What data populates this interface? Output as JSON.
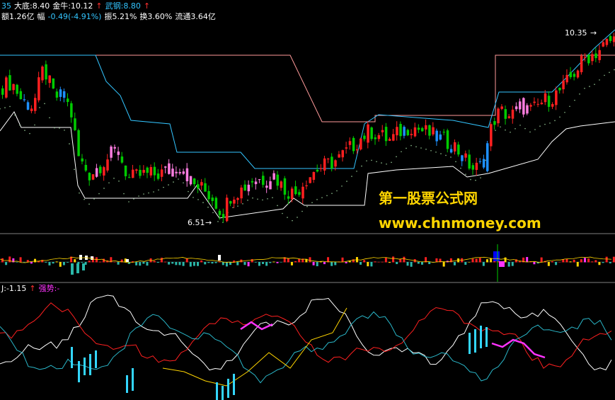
{
  "header": {
    "line1": [
      {
        "text": "35",
        "color": "#33c5ff"
      },
      {
        "text": "大底:8.40",
        "color": "#ffffff"
      },
      {
        "text": "金牛:10.12",
        "color": "#ffffff"
      },
      {
        "text": "↑",
        "color": "#ff3030"
      },
      {
        "text": "武钢:8.80",
        "color": "#33c5ff"
      },
      {
        "text": "↑",
        "color": "#ff3030"
      }
    ],
    "line2": [
      {
        "text": "额1.26亿",
        "color": "#ffffff"
      },
      {
        "text": "幅",
        "color": "#ffffff"
      },
      {
        "text": "-0.49(-4.91%)",
        "color": "#33c5ff"
      },
      {
        "text": "振5.21%",
        "color": "#ffffff"
      },
      {
        "text": "换3.60%",
        "color": "#ffffff"
      },
      {
        "text": "流通3.64亿",
        "color": "#ffffff"
      }
    ],
    "panel3": [
      {
        "text": "J:-1.15",
        "color": "#ffffff"
      },
      {
        "text": "↑",
        "color": "#ff3030"
      },
      {
        "text": "强势:-",
        "color": "#ff33ff"
      }
    ]
  },
  "annotations": {
    "high_label": "10.35",
    "low_label": "6.51",
    "arrow": "→"
  },
  "watermark": {
    "title": "第一股票公式网",
    "url": "www.chnmoney.com"
  },
  "colors": {
    "up": "#ff2020",
    "down": "#00cc00",
    "blue": "#1e90ff",
    "pink": "#ff7de0",
    "upper_band": "#ff9a9a",
    "mid_band": "#33c5ff",
    "lower_band": "#ffffff",
    "dots": "#8fbf8f",
    "divider": "#808080"
  },
  "chart_data": {
    "type": "candlestick",
    "price_min": 6.51,
    "price_max": 10.35,
    "count": 170
  }
}
